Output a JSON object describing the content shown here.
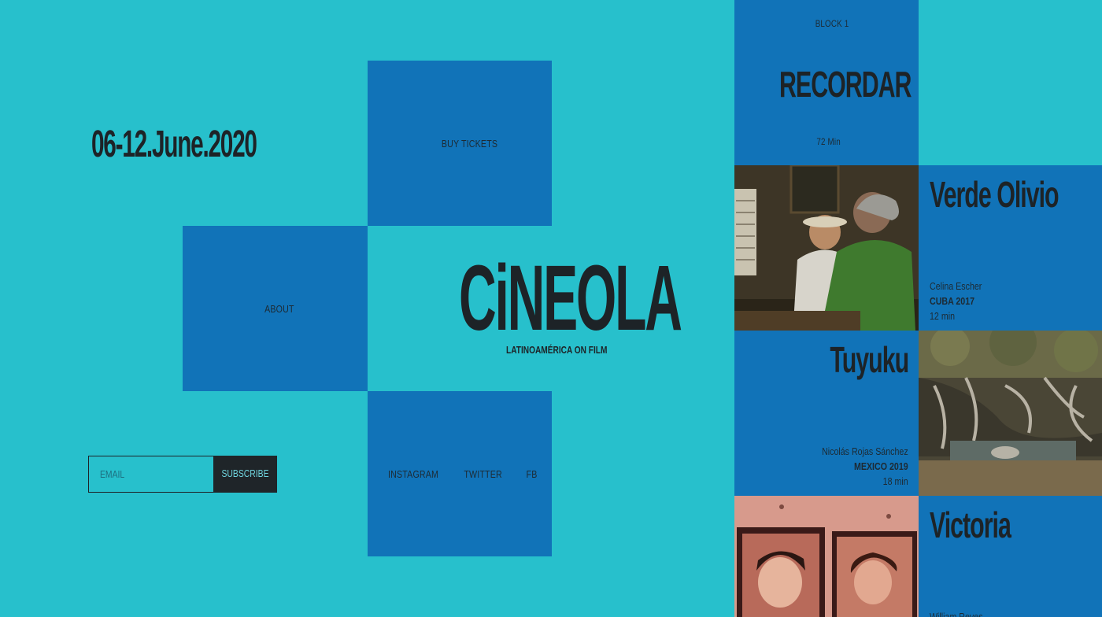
{
  "date": "06-12.June.2020",
  "nav": {
    "buy_tickets": "BUY TICKETS",
    "about": "ABOUT",
    "instagram": "INSTAGRAM",
    "twitter": "TWITTER",
    "fb": "FB"
  },
  "brand": {
    "logo": "CiNEOLA",
    "tagline": "LATINOAMÉRICA ON FILM"
  },
  "newsletter": {
    "email_placeholder": "EMAIL",
    "subscribe_label": "SUBSCRIBE"
  },
  "block": {
    "label": "BLOCK 1",
    "title": "RECORDAR",
    "duration": "72 Min"
  },
  "films": [
    {
      "title": "Verde Olivio",
      "director": "Celina Escher",
      "country": "CUBA 2017",
      "duration": "12 min"
    },
    {
      "title": "Tuyuku",
      "director": "Nicolás Rojas Sánchez",
      "country": "MEXICO 2019",
      "duration": "18 min"
    },
    {
      "title": "Victoria",
      "director": "William Reyes",
      "country": "",
      "duration": ""
    }
  ],
  "colors": {
    "background": "#27c0cc",
    "tile": "#1173b8",
    "ink": "#1d2327"
  }
}
